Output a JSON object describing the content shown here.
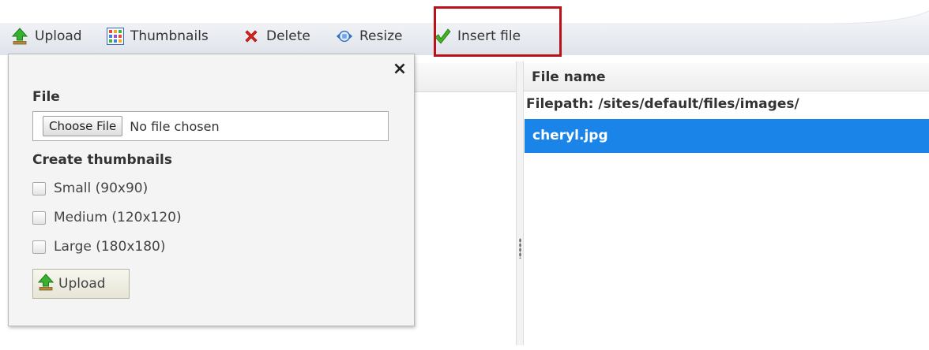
{
  "toolbar": {
    "items": [
      {
        "label": "Upload",
        "icon": "upload-arrow-icon"
      },
      {
        "label": "Thumbnails",
        "icon": "thumbnails-grid-icon"
      },
      {
        "label": "Delete",
        "icon": "delete-x-icon"
      },
      {
        "label": "Resize",
        "icon": "resize-icon"
      },
      {
        "label": "Insert file",
        "icon": "checkmark-icon"
      }
    ],
    "highlight_color": "#b9121b"
  },
  "upload_popup": {
    "close_symbol": "×",
    "file_label": "File",
    "choose_button_label": "Choose File",
    "no_file_text": "No file chosen",
    "thumbnails_heading": "Create thumbnails",
    "options": [
      {
        "label": "Small (90x90)",
        "checked": false
      },
      {
        "label": "Medium (120x120)",
        "checked": false
      },
      {
        "label": "Large (180x180)",
        "checked": false
      }
    ],
    "upload_button_label": "Upload"
  },
  "file_list": {
    "column_header": "File name",
    "filepath": "Filepath: /sites/default/files/images/",
    "files": [
      {
        "name": "cheryl.jpg",
        "selected": true
      }
    ],
    "selected_color": "#1a84e8"
  }
}
